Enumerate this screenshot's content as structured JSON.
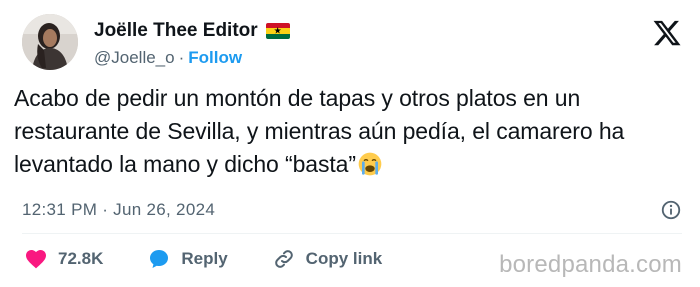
{
  "author": {
    "display_name": "Joëlle Thee Editor",
    "handle": "@Joelle_o",
    "separator": "·",
    "follow_label": "Follow",
    "flag_icon": "ghana-flag-icon",
    "avatar_icon": "avatar-photo"
  },
  "tweet": {
    "text": "Acabo de pedir un montón de tapas y otros platos en un restaurante de Sevilla, y mientras aún pedía, el ca­marero ha levantado la mano y dicho “basta”",
    "emoji_icon": "loudly-crying-face-emoji",
    "timestamp": "12:31 PM · Jun 26, 2024"
  },
  "actions": {
    "likes_count": "72.8K",
    "reply_label": "Reply",
    "copy_link_label": "Copy link"
  },
  "watermark": "boredpanda.com",
  "colors": {
    "text": "#0f1419",
    "muted": "#536471",
    "accent": "#1d9bf0",
    "like": "#f91880",
    "ghana_red": "#ce1126",
    "ghana_gold": "#fcd116",
    "ghana_green": "#006b3f"
  }
}
